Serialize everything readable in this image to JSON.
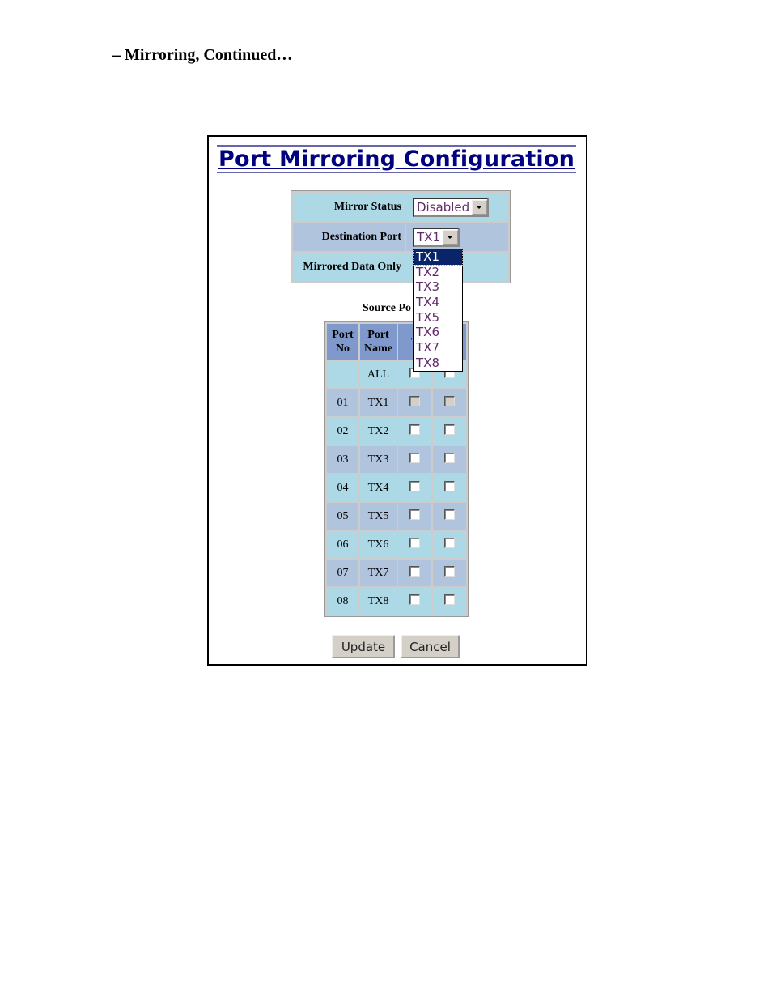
{
  "heading": "– Mirroring, Continued…",
  "title": "Port Mirroring Configuration",
  "config": {
    "mirror_status_label": "Mirror Status",
    "mirror_status_value": "Disabled",
    "destination_port_label": "Destination Port",
    "destination_port_value": "TX1",
    "mirrored_data_only_label": "Mirrored Data Only"
  },
  "destination_options": [
    "TX1",
    "TX2",
    "TX3",
    "TX4",
    "TX5",
    "TX6",
    "TX7",
    "TX8"
  ],
  "source_label": "Source Po",
  "source_table": {
    "headers": {
      "port_no": "Port No",
      "port_name": "Port Name",
      "col3": "T",
      "col4": ""
    },
    "all_label": "ALL",
    "rows": [
      {
        "no": "01",
        "name": "TX1",
        "disabled": true
      },
      {
        "no": "02",
        "name": "TX2",
        "disabled": false
      },
      {
        "no": "03",
        "name": "TX3",
        "disabled": false
      },
      {
        "no": "04",
        "name": "TX4",
        "disabled": false
      },
      {
        "no": "05",
        "name": "TX5",
        "disabled": false
      },
      {
        "no": "06",
        "name": "TX6",
        "disabled": false
      },
      {
        "no": "07",
        "name": "TX7",
        "disabled": false
      },
      {
        "no": "08",
        "name": "TX8",
        "disabled": false
      }
    ]
  },
  "buttons": {
    "update": "Update",
    "cancel": "Cancel"
  },
  "colors": {
    "title": "#000080",
    "row_a": "#add8e6",
    "row_b": "#b0c4de",
    "header": "#7f99cc",
    "selected": "#0a246a"
  }
}
